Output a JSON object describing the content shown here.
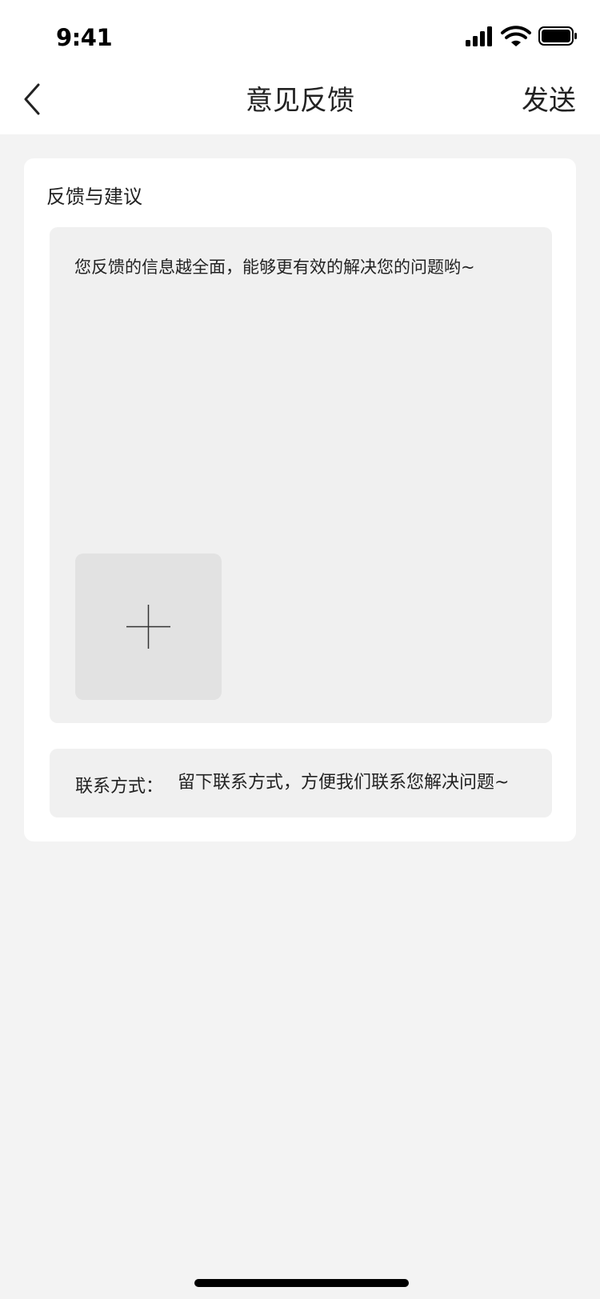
{
  "status_bar": {
    "time": "9:41"
  },
  "nav": {
    "title": "意见反馈",
    "send_label": "发送",
    "back_icon": "chevron-left-icon"
  },
  "feedback": {
    "section_title": "反馈与建议",
    "placeholder": "您反馈的信息越全面，能够更有效的解决您的问题哟~",
    "add_image_icon": "plus-icon"
  },
  "contact": {
    "label": "联系方式：",
    "placeholder": "留下联系方式，方便我们联系您解决问题~"
  },
  "colors": {
    "page_background": "#f3f3f3",
    "card_background": "#ffffff",
    "input_background": "#f0f0f0",
    "add_button_background": "#e2e2e2",
    "text": "#222222"
  }
}
